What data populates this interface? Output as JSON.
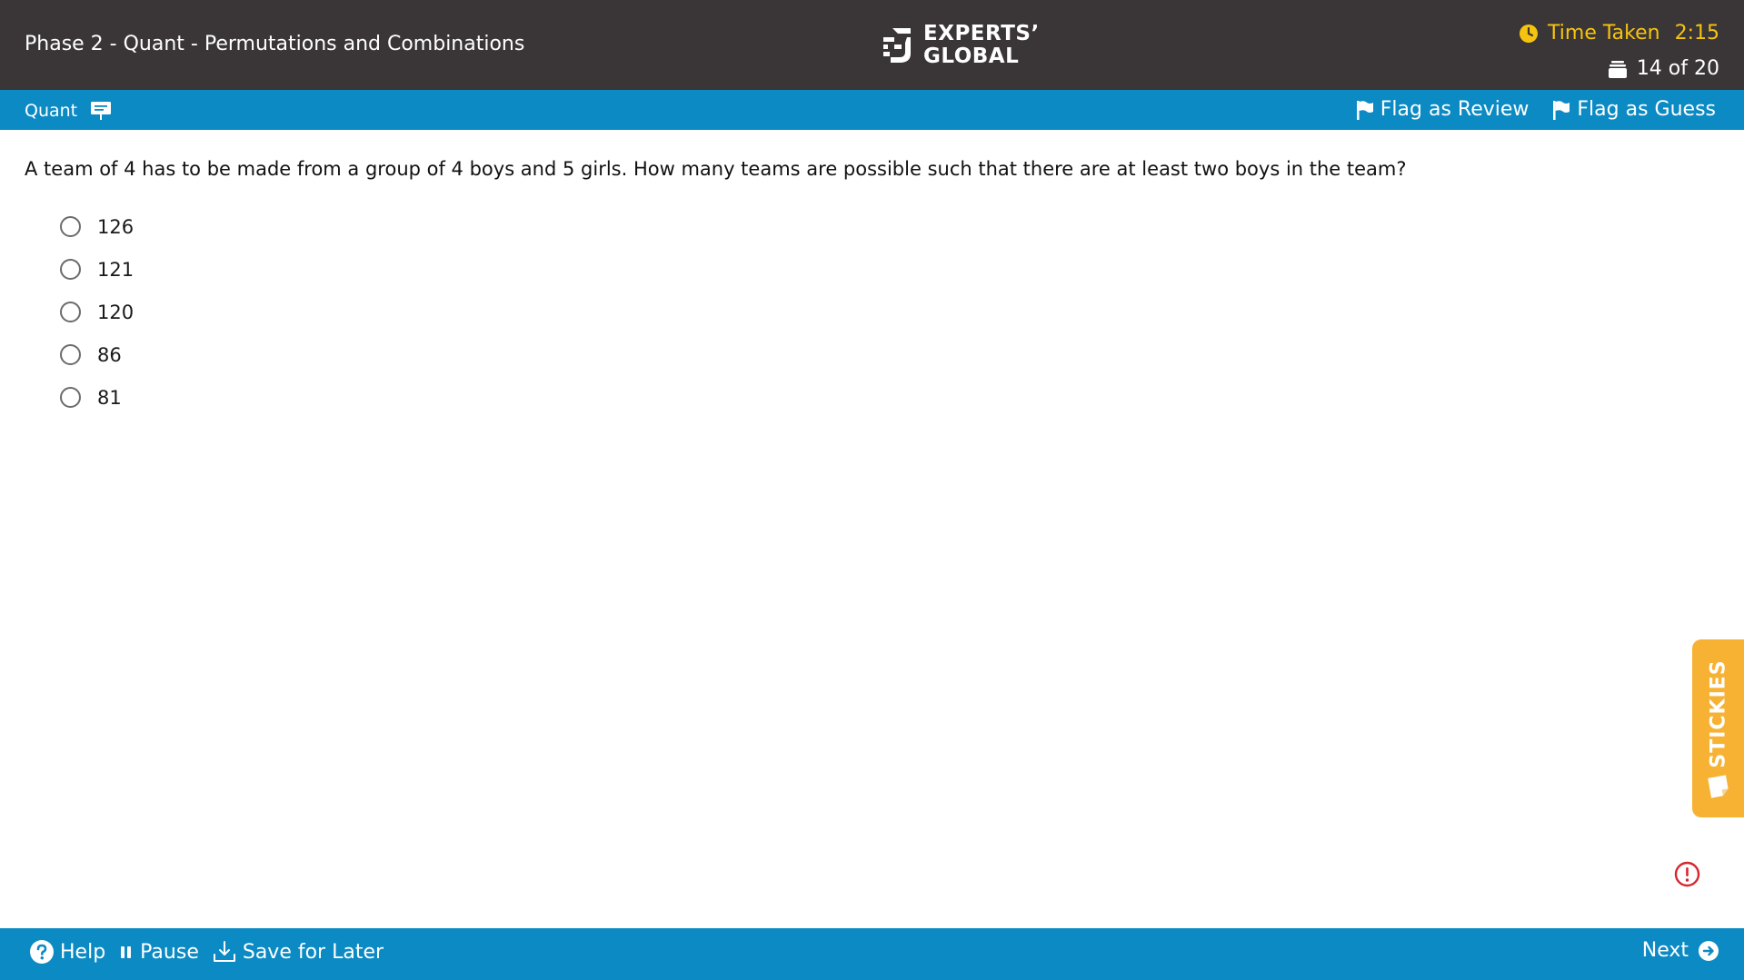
{
  "header": {
    "test_title": "Phase 2 - Quant - Permutations and Combinations",
    "logo_line1": "EXPERTS’",
    "logo_line2": "GLOBAL",
    "timer_label": "Time Taken",
    "timer_value": "2:15",
    "progress": "14 of 20"
  },
  "section_bar": {
    "section_name": "Quant",
    "flag_review": "Flag as Review",
    "flag_guess": "Flag as Guess"
  },
  "question": {
    "text": "A team of 4 has to be made from a group of 4 boys and 5 girls. How many teams are possible such that there are at least two boys in the team?",
    "options": [
      "126",
      "121",
      "120",
      "86",
      "81"
    ]
  },
  "stickies": {
    "label": "STICKIES"
  },
  "footer": {
    "help": "Help",
    "pause": "Pause",
    "save_later": "Save for Later",
    "next": "Next"
  },
  "colors": {
    "header_bg": "#3a3536",
    "bar_blue": "#0b8ac4",
    "timer_yellow": "#f6c40f",
    "stickies_orange": "#f7b234",
    "report_red": "#d7262c"
  },
  "icons": {
    "section": "presentation-board-icon",
    "timer": "clock-icon",
    "progress": "stack-icon",
    "flag": "flag-icon",
    "help": "question-circle-icon",
    "pause": "pause-icon",
    "save": "download-icon",
    "next": "arrow-right-circle-icon",
    "report": "exclamation-circle-icon",
    "stickies": "sticky-note-icon"
  }
}
